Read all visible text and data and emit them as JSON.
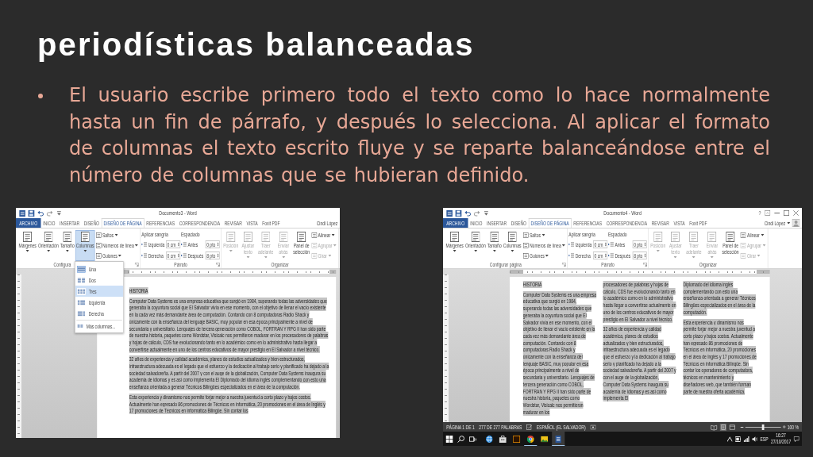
{
  "slide": {
    "title": "periodísticas balanceadas",
    "bullets": [
      "El usuario escribe primero todo el texto como lo hace normalmente hasta un fin de párrafo, y después lo selecciona. Al aplicar el formato de columnas el texto escrito fluye y se reparte balanceándose entre el número de columnas que se hubieran definido."
    ]
  },
  "screenshots": [
    {
      "title": "Documento3 - Word",
      "tabs": [
        {
          "label": "ARCHIVO",
          "kind": "file",
          "selected": false
        },
        {
          "label": "INICIO",
          "kind": "tab",
          "selected": false
        },
        {
          "label": "INSERTAR",
          "kind": "tab",
          "selected": false
        },
        {
          "label": "DISEÑO",
          "kind": "tab",
          "selected": false
        },
        {
          "label": "DISEÑO DE PÁGINA",
          "kind": "tab",
          "selected": true
        },
        {
          "label": "REFERENCIAS",
          "kind": "tab",
          "selected": false
        },
        {
          "label": "CORRESPONDENCIA",
          "kind": "tab",
          "selected": false
        },
        {
          "label": "REVISAR",
          "kind": "tab",
          "selected": false
        },
        {
          "label": "VISTA",
          "kind": "tab",
          "selected": false
        },
        {
          "label": "Foxit PDF",
          "kind": "tab",
          "selected": false
        }
      ],
      "user": {
        "name": "Cindi López"
      },
      "ribbon_groups": [
        {
          "label": "Configura",
          "dialog_launcher": true,
          "stacks": [
            [
              {
                "kind": "large",
                "label": "Márgenes",
                "caret": true,
                "pressed": false,
                "disabled": false
              }
            ],
            [
              {
                "kind": "large",
                "label": "Orientación",
                "caret": true,
                "pressed": false,
                "disabled": false
              }
            ],
            [
              {
                "kind": "large",
                "label": "Tamaño",
                "caret": true,
                "pressed": false,
                "disabled": false
              }
            ],
            [
              {
                "kind": "large",
                "label": "Columnas",
                "caret": true,
                "pressed": true,
                "disabled": false
              }
            ],
            [
              {
                "kind": "small",
                "label": "Saltos",
                "caret": true,
                "disabled": false
              },
              {
                "kind": "small",
                "label": "Números de línea",
                "caret": true,
                "disabled": false
              },
              {
                "kind": "small",
                "label": "Guiones",
                "caret": true,
                "disabled": false
              }
            ]
          ]
        },
        {
          "label": "Párrafo",
          "dialog_launcher": true,
          "stacks": [
            [
              {
                "kind": "heading",
                "label": "Aplicar sangría"
              },
              {
                "kind": "spin",
                "label": "Izquierda",
                "value": "0 cm"
              },
              {
                "kind": "spin",
                "label": "Derecha",
                "value": "0 cm"
              }
            ],
            [
              {
                "kind": "heading",
                "label": "Espaciado"
              },
              {
                "kind": "spin",
                "label": "Antes",
                "value": "0 pto"
              },
              {
                "kind": "spin",
                "label": "Después",
                "value": "8 pto"
              }
            ]
          ]
        },
        {
          "label": "Organizar",
          "dialog_launcher": false,
          "stacks": [
            [
              {
                "kind": "large",
                "label": "Posición",
                "caret": true,
                "pressed": false,
                "disabled": true
              }
            ],
            [
              {
                "kind": "large",
                "label": "Ajustar texto",
                "caret": true,
                "pressed": false,
                "disabled": true
              }
            ],
            [
              {
                "kind": "large",
                "label": "Traer adelante",
                "caret": true,
                "pressed": false,
                "disabled": true
              }
            ],
            [
              {
                "kind": "large",
                "label": "Enviar atrás",
                "caret": true,
                "pressed": false,
                "disabled": true
              }
            ],
            [
              {
                "kind": "large",
                "label": "Panel de selección",
                "caret": false,
                "pressed": false,
                "disabled": false
              }
            ],
            [
              {
                "kind": "small",
                "label": "Alinear",
                "caret": true,
                "disabled": false
              },
              {
                "kind": "small",
                "label": "Agrupar",
                "caret": true,
                "disabled": true
              },
              {
                "kind": "small",
                "label": "Girar",
                "caret": true,
                "disabled": true
              }
            ]
          ]
        }
      ],
      "column_menu": {
        "items": [
          {
            "label": "Una",
            "checked": true,
            "selected": false
          },
          {
            "label": "Dos",
            "checked": false,
            "selected": false
          },
          {
            "label": "Tres",
            "checked": false,
            "selected": true
          },
          {
            "label": "Izquierda",
            "checked": false,
            "selected": false
          },
          {
            "label": "Derecha",
            "checked": false,
            "selected": false
          }
        ],
        "more": "Más columnas..."
      },
      "document": {
        "columns": [
          {
            "paragraphs": [
              "HISTORIA",
              "Computer Data Systems es una empresa educativa que surgió en 1984, superando todas las adversidades que generaba la coyuntura social que El Salvador vivía en ese momento, con el objetivo de llenar el vacío existente en la cada vez más demandante área de computación. Contando con 8 computadoras Radio Shack y únicamente con la enseñanza del lenguaje BASIC, muy popular en esa época principalmente a nivel de secundaria y universitario. Lenguajes de tercera generación como COBOL, FORTRAN Y RPG II han sido parte de nuestra historia, paquetes como Wordstar, Visicalc nos permitieron madurar en los procesadores de palabras y hojas de cálculo, CDS fue evolucionando tanto en lo académico como en lo administrativo hasta llegar a convertirse actualmente en uno de los centros educativos de mayor prestigio en El Salvador a nivel técnico.",
              "32 años de experiencia y calidad académica, planes de estudios actualizados y bien estructurados, infraestructura adecuada es el legado que el esfuerzo y la dedicación al trabajo serio y planificado ha dejado a la sociedad salvadoreña. A partir del 2007 y con el auge de la globalización, Computer Data Systems inaugura su academia de idiomas y es así como implementa El Diplomado del idioma inglés complementando con esto una enseñanza orientada a generar Técnicos Bilingües especializados en el área de la computación.",
              "Esta experiencia y dinamismo nos permite forjar mejor a nuestra juventud a corto plazo y bajos costos. Actualmente han egresado 86 promociones de Técnicos en informática, 20 promociones en el área de Inglés y 17 promociones de Técnicos en informática Bilingüe. Sin contar los"
            ]
          }
        ]
      }
    },
    {
      "title": "Documento4 - Word",
      "window_controls": {
        "help": "?"
      },
      "tabs": [
        {
          "label": "ARCHIVO",
          "kind": "file",
          "selected": false
        },
        {
          "label": "INICIO",
          "kind": "tab",
          "selected": false
        },
        {
          "label": "INSERTAR",
          "kind": "tab",
          "selected": false
        },
        {
          "label": "DISEÑO",
          "kind": "tab",
          "selected": false
        },
        {
          "label": "DISEÑO DE PÁGINA",
          "kind": "tab",
          "selected": true
        },
        {
          "label": "REFERENCIAS",
          "kind": "tab",
          "selected": false
        },
        {
          "label": "CORRESPONDENCIA",
          "kind": "tab",
          "selected": false
        },
        {
          "label": "REVISAR",
          "kind": "tab",
          "selected": false
        },
        {
          "label": "VISTA",
          "kind": "tab",
          "selected": false
        },
        {
          "label": "Foxit PDF",
          "kind": "tab",
          "selected": false
        }
      ],
      "user": {
        "name": "Cindi López",
        "avatar": true
      },
      "ribbon_groups": [
        {
          "label": "Configurar página",
          "dialog_launcher": true,
          "stacks": [
            [
              {
                "kind": "large",
                "label": "Márgenes",
                "caret": true,
                "pressed": false,
                "disabled": false
              }
            ],
            [
              {
                "kind": "large",
                "label": "Orientación",
                "caret": true,
                "pressed": false,
                "disabled": false
              }
            ],
            [
              {
                "kind": "large",
                "label": "Tamaño",
                "caret": true,
                "pressed": false,
                "disabled": false
              }
            ],
            [
              {
                "kind": "large",
                "label": "Columnas",
                "caret": true,
                "pressed": false,
                "disabled": false
              }
            ],
            [
              {
                "kind": "small",
                "label": "Saltos",
                "caret": true,
                "disabled": false
              },
              {
                "kind": "small",
                "label": "Números de línea",
                "caret": true,
                "disabled": false
              },
              {
                "kind": "small",
                "label": "Guiones",
                "caret": true,
                "disabled": false
              }
            ]
          ]
        },
        {
          "label": "Párrafo",
          "dialog_launcher": true,
          "stacks": [
            [
              {
                "kind": "heading",
                "label": "Aplicar sangría"
              },
              {
                "kind": "spin",
                "label": "Izquierda",
                "value": "0 cm"
              },
              {
                "kind": "spin",
                "label": "Derecha",
                "value": "0 cm"
              }
            ],
            [
              {
                "kind": "heading",
                "label": "Espaciado"
              },
              {
                "kind": "spin",
                "label": "Antes",
                "value": "0 pto"
              },
              {
                "kind": "spin",
                "label": "Después",
                "value": "8 pto"
              }
            ]
          ]
        },
        {
          "label": "Organizar",
          "dialog_launcher": false,
          "stacks": [
            [
              {
                "kind": "large",
                "label": "Posición",
                "caret": true,
                "pressed": false,
                "disabled": true
              }
            ],
            [
              {
                "kind": "large",
                "label": "Ajustar texto",
                "caret": true,
                "pressed": false,
                "disabled": true
              }
            ],
            [
              {
                "kind": "large",
                "label": "Traer adelante",
                "caret": true,
                "pressed": false,
                "disabled": true
              }
            ],
            [
              {
                "kind": "large",
                "label": "Enviar atrás",
                "caret": true,
                "pressed": false,
                "disabled": true
              }
            ],
            [
              {
                "kind": "large",
                "label": "Panel de selección",
                "caret": false,
                "pressed": false,
                "disabled": false
              }
            ],
            [
              {
                "kind": "small",
                "label": "Alinear",
                "caret": true,
                "disabled": false
              },
              {
                "kind": "small",
                "label": "Agrupar",
                "caret": true,
                "disabled": true
              },
              {
                "kind": "small",
                "label": "Girar",
                "caret": true,
                "disabled": true
              }
            ]
          ]
        }
      ],
      "document": {
        "columns": [
          {
            "paragraphs": [
              "HISTORIA",
              "Computer Data Systems es una empresa educativa que surgió en 1984, superando todas las adversidades que generaba la coyuntura social que El Salvador vivía en ese momento, con el objetivo de llenar el vacío existente en la cada vez más demandante área de computación. Contando con 8 computadoras Radio Shack y únicamente con la enseñanza del lenguaje BASIC, muy popular en esa época principalmente a nivel de secundaria y universitario. Lenguajes de tercera generación como COBOL, FORTRAN Y RPG II han sido parte de nuestra historia, paquetes como Wordstar, Visicalc nos permitieron madurar en los"
            ]
          },
          {
            "paragraphs": [
              "procesadores de palabras y hojas de cálculo, CDS fue evolucionando tanto en lo académico como en lo administrativo hasta llegar a convertirse actualmente en uno de los centros educativos de mayor prestigio en El Salvador a nivel técnico.",
              "32 años de experiencia y calidad académica, planes de estudios actualizados y bien estructurados, infraestructura adecuada es el legado que el esfuerzo y la dedicación al trabajo serio y planificado ha dejado a la sociedad salvadoreña. A partir del 2007 y con el auge de la globalización, Computer Data Systems inaugura su academia de idiomas y es así como implementa El"
            ]
          },
          {
            "paragraphs": [
              "Diplomado del idioma inglés complementando con esto una enseñanza orientada a generar Técnicos Bilingües especializados en el área de la computación.",
              "Esta experiencia y dinamismo nos permite forjar mejor a nuestra juventud a corto plazo y bajos costos. Actualmente han egresado 86 promociones de Técnicos en informática, 20 promociones en el área de Inglés y 17 promociones de Técnicos en informática Bilingüe. Sin contar los operadores de computadora, técnicos en mantenimiento y diseñadores web, que también forman parte de nuestra oferta académica."
            ]
          }
        ]
      },
      "status_bar": {
        "page": "PÁGINA 1 DE 1",
        "words": "277 DE 277 PALABRAS",
        "language": "ESPAÑOL (EL SALVADOR)",
        "views": [
          {
            "selected": false
          },
          {
            "selected": true
          },
          {
            "selected": false
          }
        ],
        "zoom": {
          "level": 0.5,
          "reading": "100 %"
        }
      },
      "taskbar": {
        "apps": [
          {
            "running": false,
            "active": false
          },
          {
            "running": false,
            "active": false
          },
          {
            "running": false,
            "active": false
          },
          {
            "running": true,
            "active": false
          },
          {
            "running": false,
            "active": false
          },
          {
            "running": true,
            "active": true
          }
        ],
        "language": "ESP",
        "time": "16:27",
        "date": "27/10/2017"
      }
    }
  ]
}
